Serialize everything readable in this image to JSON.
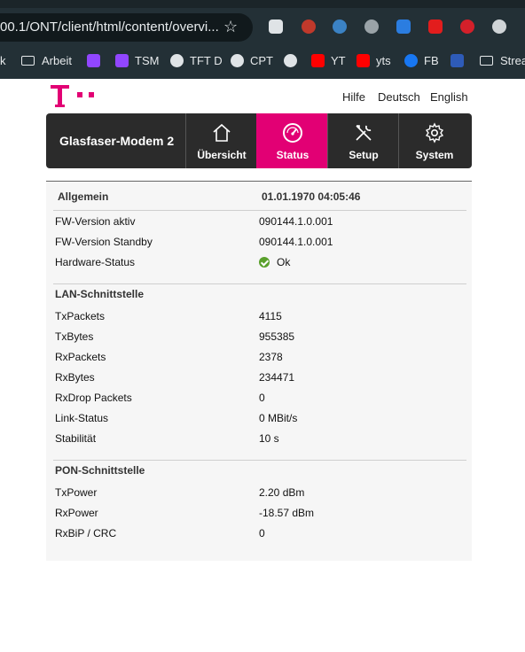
{
  "browser": {
    "url": "00.1/ONT/client/html/content/overvi...",
    "bookmarks": [
      {
        "label": "k"
      },
      {
        "label": "Arbeit"
      },
      {
        "label": ""
      },
      {
        "label": "TSM"
      },
      {
        "label": "TFT D"
      },
      {
        "label": "CPT"
      },
      {
        "label": ""
      },
      {
        "label": "YT"
      },
      {
        "label": "yts"
      },
      {
        "label": "FB"
      },
      {
        "label": ""
      },
      {
        "label": "Strea"
      }
    ]
  },
  "header": {
    "links": [
      "Hilfe",
      "Deutsch",
      "English"
    ]
  },
  "nav": {
    "device_name": "Glasfaser-Modem 2",
    "tabs": [
      {
        "label": "Übersicht",
        "icon": "home-icon"
      },
      {
        "label": "Status",
        "icon": "speedometer-icon",
        "active": true
      },
      {
        "label": "Setup",
        "icon": "tools-icon"
      },
      {
        "label": "System",
        "icon": "gear-icon"
      }
    ]
  },
  "status": {
    "general_label": "Allgemein",
    "datetime": "01.01.1970 04:05:46",
    "general_rows": [
      {
        "label": "FW-Version aktiv",
        "value": "090144.1.0.001"
      },
      {
        "label": "FW-Version Standby",
        "value": "090144.1.0.001"
      },
      {
        "label": "Hardware-Status",
        "value": "Ok",
        "status_color": "#5aa02c"
      }
    ],
    "lan_label": "LAN-Schnittstelle",
    "lan_rows": [
      {
        "label": "TxPackets",
        "value": "4115"
      },
      {
        "label": "TxBytes",
        "value": "955385"
      },
      {
        "label": "RxPackets",
        "value": "2378"
      },
      {
        "label": "RxBytes",
        "value": "234471"
      },
      {
        "label": "RxDrop Packets",
        "value": "0"
      },
      {
        "label": "Link-Status",
        "value": "0 MBit/s"
      },
      {
        "label": "Stabilität",
        "value": "10 s"
      }
    ],
    "pon_label": "PON-Schnittstelle",
    "pon_rows": [
      {
        "label": "TxPower",
        "value": "2.20 dBm"
      },
      {
        "label": "RxPower",
        "value": "-18.57 dBm"
      },
      {
        "label": "RxBiP / CRC",
        "value": "0"
      }
    ]
  },
  "colors": {
    "brand_magenta": "#e20074",
    "nav_dark": "#2b2b2b",
    "status_ok": "#5aa02c"
  }
}
